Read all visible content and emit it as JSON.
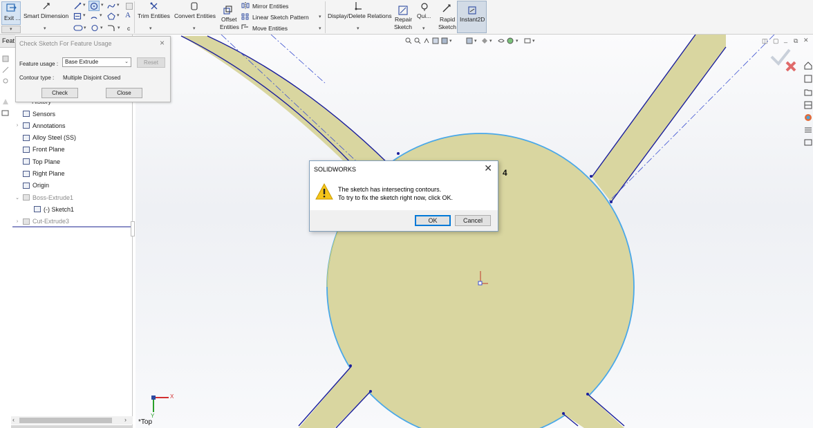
{
  "ribbon": {
    "exit_label": "Exit ...",
    "smart_dimension": "Smart Dimension",
    "trim_entities": "Trim Entities",
    "convert_entities": "Convert Entities",
    "offset_entities_1": "Offset",
    "offset_entities_2": "Entities",
    "mirror_entities": "Mirror Entities",
    "linear_sketch_pattern": "Linear Sketch Pattern",
    "move_entities": "Move Entities",
    "display_delete_relations": "Display/Delete Relations",
    "repair_sketch_1": "Repair",
    "repair_sketch_2": "Sketch",
    "quick_snaps": "Qui...",
    "rapid_sketch_1": "Rapid",
    "rapid_sketch_2": "Sketch",
    "instant2d": "Instant2D",
    "small_c": "c"
  },
  "check_panel": {
    "title": "Check Sketch For Feature Usage",
    "feature_usage_label": "Feature usage :",
    "feature_usage_value": "Base Extrude",
    "reset_label": "Reset",
    "contour_type_label": "Contour type :",
    "contour_type_value": "Multiple Disjoint Closed",
    "check_label": "Check",
    "close_label": "Close"
  },
  "tree": {
    "tab_label": "Feat",
    "history_partial": "History",
    "items": [
      {
        "label": "Sensors",
        "icon": "sensors-icon",
        "expand": "",
        "greyed": false
      },
      {
        "label": "Annotations",
        "icon": "annotations-icon",
        "expand": "›",
        "greyed": false
      },
      {
        "label": "Alloy Steel (SS)",
        "icon": "material-icon",
        "expand": "",
        "greyed": false
      },
      {
        "label": "Front Plane",
        "icon": "plane-icon",
        "expand": "",
        "greyed": false
      },
      {
        "label": "Top Plane",
        "icon": "plane-icon",
        "expand": "",
        "greyed": false
      },
      {
        "label": "Right Plane",
        "icon": "plane-icon",
        "expand": "",
        "greyed": false
      },
      {
        "label": "Origin",
        "icon": "origin-icon",
        "expand": "",
        "greyed": false
      },
      {
        "label": "Boss-Extrude1",
        "icon": "extrude-icon",
        "expand": "⌄",
        "greyed": true
      },
      {
        "label": "(-) Sketch1",
        "icon": "sketch-icon",
        "expand": "",
        "greyed": false
      },
      {
        "label": "Cut-Extrude3",
        "icon": "cut-extrude-icon",
        "expand": "›",
        "greyed": true
      }
    ]
  },
  "viewport": {
    "dimension_label": "4",
    "view_name": "*Top",
    "axis_x": "X",
    "axis_y": "Y"
  },
  "dialog": {
    "title": "SOLIDWORKS",
    "message_line1": "The sketch has intersecting contours.",
    "message_line2": "To try to fix the sketch right now, click OK.",
    "ok_label": "OK",
    "cancel_label": "Cancel",
    "close_glyph": "✕"
  },
  "colors": {
    "sketch_fill": "#d9d6a0",
    "sketch_line": "#1b1f9c",
    "selected_edge": "#4aa8e8",
    "construction_line": "#3a4fd0"
  }
}
